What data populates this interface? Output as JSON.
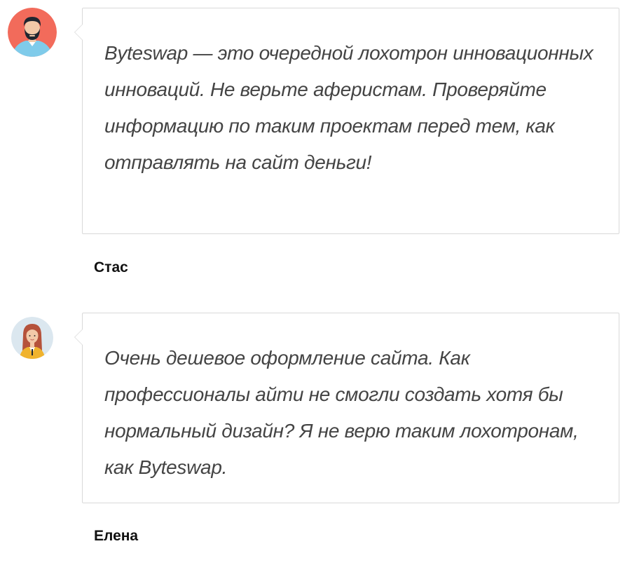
{
  "reviews": [
    {
      "avatar_icon": "man-beard-avatar-icon",
      "text": "Byteswap — это очередной лохотрон инновационных инноваций. Не верьте аферистам. Проверяйте информацию по таким проектам перед тем, как отправлять на сайт деньги!",
      "author": "Стас"
    },
    {
      "avatar_icon": "woman-avatar-icon",
      "text": "Очень дешевое оформление сайта. Как профессионалы айти не смогли создать хотя бы нормальный дизайн? Я не верю таким лохотронам, как Byteswap.",
      "author": "Елена"
    }
  ],
  "colors": {
    "avatar1_bg": "#f26b5b",
    "avatar2_bg": "#dbe7ef",
    "bubble_border": "#d9d9d9",
    "review_text": "#444444",
    "author_text": "#111111"
  }
}
